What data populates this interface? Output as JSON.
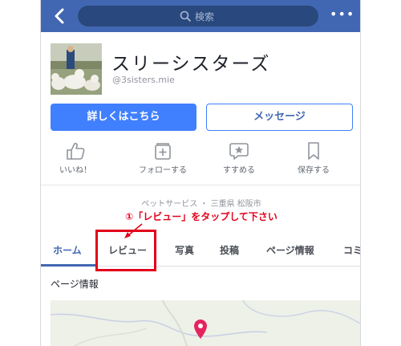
{
  "header": {
    "search_placeholder": "検索"
  },
  "page": {
    "name": "スリーシスターズ",
    "handle": "@3sisters.mie"
  },
  "buttons": {
    "learn_more": "詳しくはこちら",
    "message": "メッセージ"
  },
  "actions": {
    "like": "いいね！",
    "follow": "フォローする",
    "recommend": "すすめる",
    "save": "保存する"
  },
  "info": {
    "category": "ペットサービス ・ 三重県 松阪市"
  },
  "annotation": {
    "text": "①「レビュー」をタップして下さい"
  },
  "tabs": [
    "ホーム",
    "レビュー",
    "写真",
    "投稿",
    "ページ情報",
    "コミ"
  ],
  "section": {
    "title": "ページ情報"
  },
  "colors": {
    "brand": "#4267b2",
    "primary_button": "#4080ff",
    "annotation": "#e2001a",
    "map_pin": "#e4245f"
  }
}
